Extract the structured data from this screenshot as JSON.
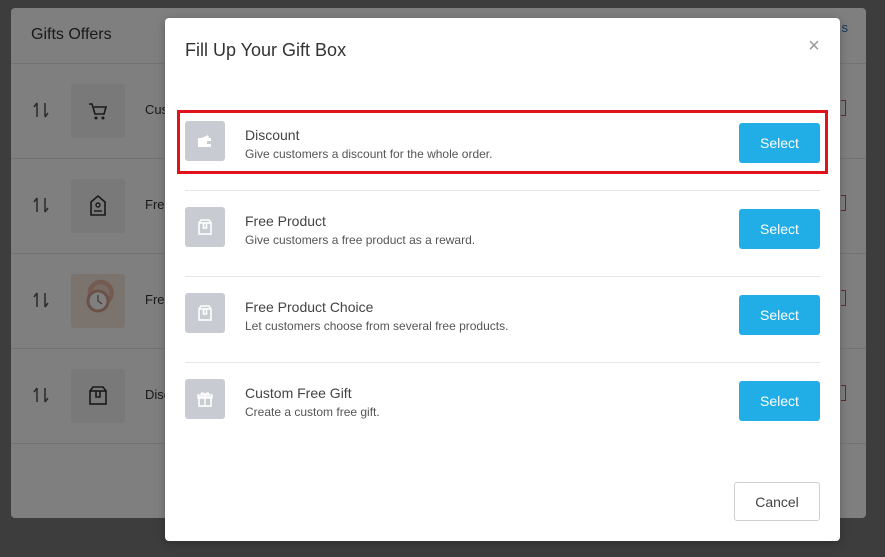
{
  "background": {
    "title": "Gifts Offers",
    "header_link": "s",
    "rows": [
      {
        "text": "Cus",
        "icon": "cart-icon"
      },
      {
        "text": "Free",
        "icon": "tag-icon"
      },
      {
        "text": "Free",
        "icon": "watch-photo"
      },
      {
        "text": "Disc",
        "icon": "box-icon"
      }
    ]
  },
  "modal": {
    "title": "Fill Up Your Gift Box",
    "close_label": "×",
    "options": [
      {
        "name": "Discount",
        "desc": "Give customers a discount for the whole order.",
        "button": "Select",
        "icon": "wallet-icon"
      },
      {
        "name": "Free Product",
        "desc": "Give customers a free product as a reward.",
        "button": "Select",
        "icon": "box-icon"
      },
      {
        "name": "Free Product Choice",
        "desc": "Let customers choose from several free products.",
        "button": "Select",
        "icon": "box-icon"
      },
      {
        "name": "Custom Free Gift",
        "desc": "Create a custom free gift.",
        "button": "Select",
        "icon": "gift-icon"
      }
    ],
    "cancel_label": "Cancel"
  },
  "colors": {
    "primary": "#21aee7",
    "highlight": "#e0121b",
    "icon_bg": "#c8ccd2"
  }
}
